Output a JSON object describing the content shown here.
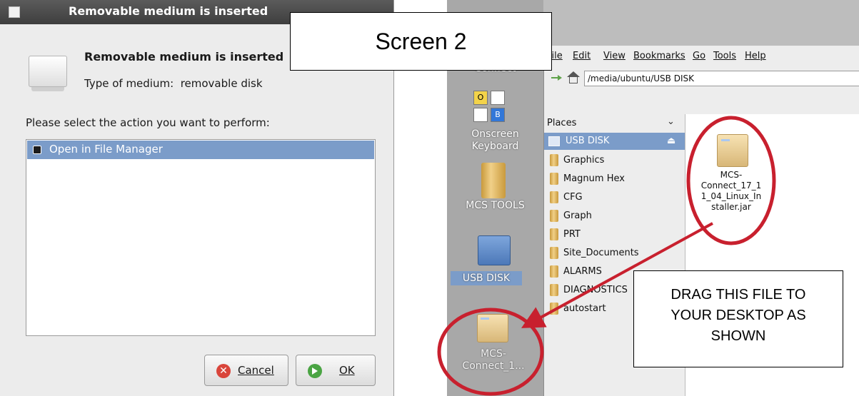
{
  "dialog": {
    "title": "Removable medium is inserted",
    "heading": "Removable medium is inserted",
    "type_label": "Type of medium:",
    "type_value": "removable disk",
    "prompt": "Please select the action you want to perform:",
    "actions": [
      {
        "label": "Open in File Manager"
      }
    ],
    "cancel_label": "Cancel",
    "ok_label": "OK"
  },
  "callouts": {
    "screen": "Screen 2",
    "drag_line1": "DRAG THIS FILE TO",
    "drag_line2": "YOUR DESKTOP AS",
    "drag_line3": "SHOWN"
  },
  "desktop": {
    "connect_label": "Connect",
    "onscreen_line1": "Onscreen",
    "onscreen_line2": "Keyboard",
    "kb_o": "O",
    "kb_b": "B",
    "mcs_tools_label": "MCS TOOLS",
    "usb_disk_label": "USB DISK",
    "mcs_file_line1": "MCS-",
    "mcs_file_line2": "Connect_1..."
  },
  "file_manager": {
    "menu": [
      "File",
      "Edit",
      "View",
      "Bookmarks",
      "Go",
      "Tools",
      "Help"
    ],
    "path": "/media/ubuntu/USB DISK",
    "places_label": "Places",
    "usb_disk": "USB DISK",
    "folders": [
      "Graphics",
      "Magnum Hex",
      "CFG",
      "Graph",
      "PRT",
      "Site_Documents",
      "ALARMS",
      "DIAGNOSTICS",
      "autostart"
    ],
    "file": {
      "line1": "MCS-",
      "line2": "Connect_17_1",
      "line3": "1_04_Linux_In",
      "line4": "staller.jar"
    }
  },
  "colors": {
    "highlight_circle": "#c8202e",
    "selection": "#7b9cc9"
  }
}
